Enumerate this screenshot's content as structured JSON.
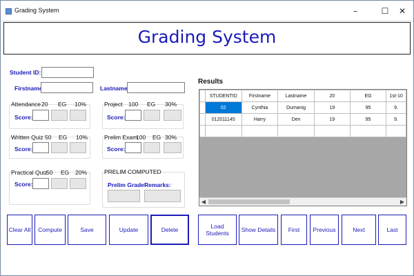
{
  "window": {
    "title": "Grading System",
    "controls": {
      "minimize": "–",
      "maximize": "☐",
      "close": "✕"
    }
  },
  "header": {
    "title": "Grading System"
  },
  "student": {
    "id_label": "Student ID:",
    "firstname_label": "Firstname:",
    "lastname_label": "Lastname:"
  },
  "groups": {
    "attendance": {
      "title": "Attendance",
      "items": "20",
      "eg": "EG",
      "pct": "10%",
      "score_label": "Score:"
    },
    "project": {
      "title": "Project",
      "items": "100",
      "eg": "EG",
      "pct": "30%",
      "score_label": "Score:"
    },
    "written_quiz": {
      "title": "Written Quiz",
      "items": "50",
      "eg": "EG",
      "pct": "10%",
      "score_label": "Score:"
    },
    "prelim_exam": {
      "title": "Prelim Exam",
      "items": "100",
      "eg": "EG",
      "pct": "30%",
      "score_label": "Score:"
    },
    "practical_quiz": {
      "title": "Practical Quiz",
      "items": "50",
      "eg": "EG",
      "pct": "20%",
      "score_label": "Score:"
    },
    "prelim_computed": {
      "title": "PRELIM COMPUTED",
      "grade_label": "Prelim Grade:",
      "remarks_label": "Remarks:"
    }
  },
  "results": {
    "label": "Results",
    "columns": [
      "STUDENTID",
      "Firstname",
      "Lastname",
      "20",
      "EG",
      "1st-10"
    ],
    "rows": [
      [
        "02",
        "Cynthia",
        "Dumanig",
        "19",
        "95",
        "9."
      ],
      [
        "012011145",
        "Harry",
        "Den",
        "19",
        "95",
        "9."
      ],
      [
        "",
        "",
        "",
        "",
        "",
        ""
      ]
    ]
  },
  "buttons": {
    "clear_all": "Clear All",
    "compute": "Compute",
    "save": "Save",
    "update": "Update",
    "delete": "Delete",
    "load_students": "Load Students",
    "show_details": "Show Details",
    "first": "First",
    "previous": "Previous",
    "next": "Next",
    "last": "Last"
  },
  "colors": {
    "accent": "#1a1ab8",
    "selection": "#0078d7",
    "grid_bg": "#a7a7a7"
  }
}
